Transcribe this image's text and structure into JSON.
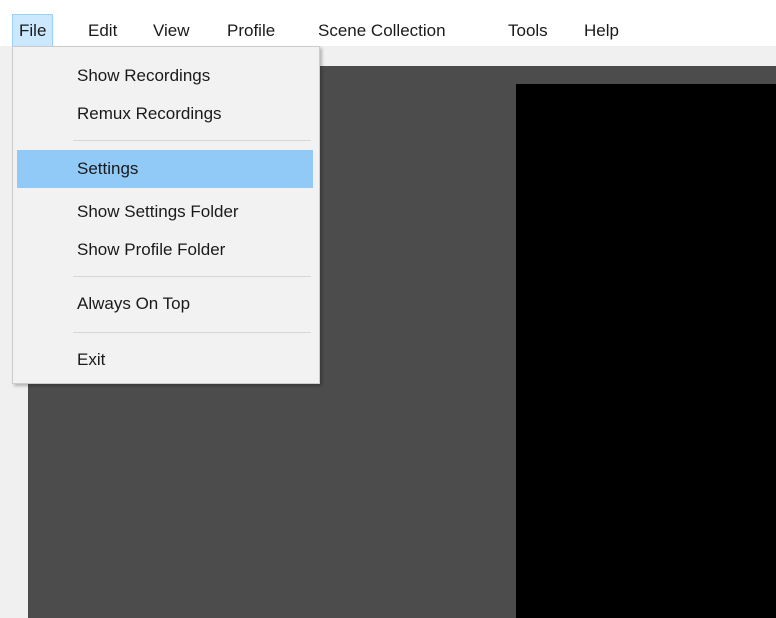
{
  "menubar": {
    "items": [
      {
        "label": "File",
        "active": true
      },
      {
        "label": "Edit"
      },
      {
        "label": "View"
      },
      {
        "label": "Profile"
      },
      {
        "label": "Scene Collection"
      },
      {
        "label": "Tools"
      },
      {
        "label": "Help"
      }
    ]
  },
  "file_menu": {
    "items": [
      {
        "label": "Show Recordings"
      },
      {
        "label": "Remux Recordings"
      },
      {
        "label": "Settings",
        "highlighted": true
      },
      {
        "label": "Show Settings Folder"
      },
      {
        "label": "Show Profile Folder"
      },
      {
        "label": "Always On Top"
      },
      {
        "label": "Exit"
      }
    ]
  },
  "colors": {
    "menu_highlight": "#91c9f7",
    "menubar_active": "#cce8ff",
    "preview_background": "#4c4c4c",
    "preview_canvas": "#000000"
  }
}
